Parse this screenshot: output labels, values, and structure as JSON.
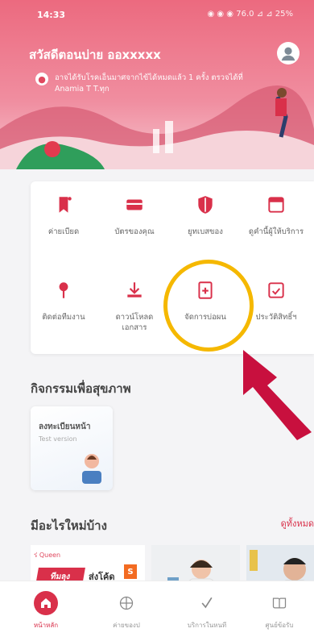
{
  "status_bar": {
    "time": "14:33",
    "right_text": "◉ ◉ ◉ 76.0 ⊿ ⊿ 25%"
  },
  "header": {
    "greeting": "สวัสดีตอนบ่าย ออxxxxx",
    "location_text": "อาจได้รับโรคเอ็นมาศจากไข้ได้หมดแล้ว 1 ครั้ง ตรวจได้ที่ Anamia T T.ทุก"
  },
  "menu": [
    {
      "label": "ค่ายเบียด",
      "icon": "bookmark-icon"
    },
    {
      "label": "บัตรของคุณ",
      "icon": "card-icon"
    },
    {
      "label": "ยูทเบสของ",
      "icon": "shield-icon"
    },
    {
      "label": "ดูคำนี้ผู้ให้บริการ",
      "icon": "calendar-icon"
    },
    {
      "label": "ติดต่อทีมงาน",
      "icon": "pin-icon"
    },
    {
      "label": "ดาวน์โหลด เอกสาร",
      "icon": "download-icon"
    },
    {
      "label": "จัดการบ่อผน",
      "icon": "document-icon"
    },
    {
      "label": "ประวัติสิทธิ์ฯ",
      "icon": "calendar-check-icon"
    }
  ],
  "activity": {
    "title": "กิจกรรมเพื่อสุขภาพ",
    "card_title": "ลงทะเบียนหน้า",
    "card_sub": "Test version"
  },
  "news": {
    "title": "มีอะไรใหม่บ้าง",
    "see_all": "ดูทั้งหมด",
    "promo_tag": "ร่ Queen",
    "promo_badge": "ทีมลุง",
    "promo_text": "ส่งโค้ด",
    "promo_s": "S"
  },
  "bottom_nav": [
    {
      "label": "หน้าหลัก",
      "icon": "home-icon",
      "active": true
    },
    {
      "label": "ค่ายของป",
      "icon": "globe-icon",
      "active": false
    },
    {
      "label": "บริการในหนที",
      "icon": "check-icon",
      "active": false
    },
    {
      "label": "ศูนย์ข้อรับ",
      "icon": "book-icon",
      "active": false
    }
  ],
  "colors": {
    "brand": "#d9304a",
    "highlight": "#f5b800",
    "header": "#ec6a7f"
  }
}
